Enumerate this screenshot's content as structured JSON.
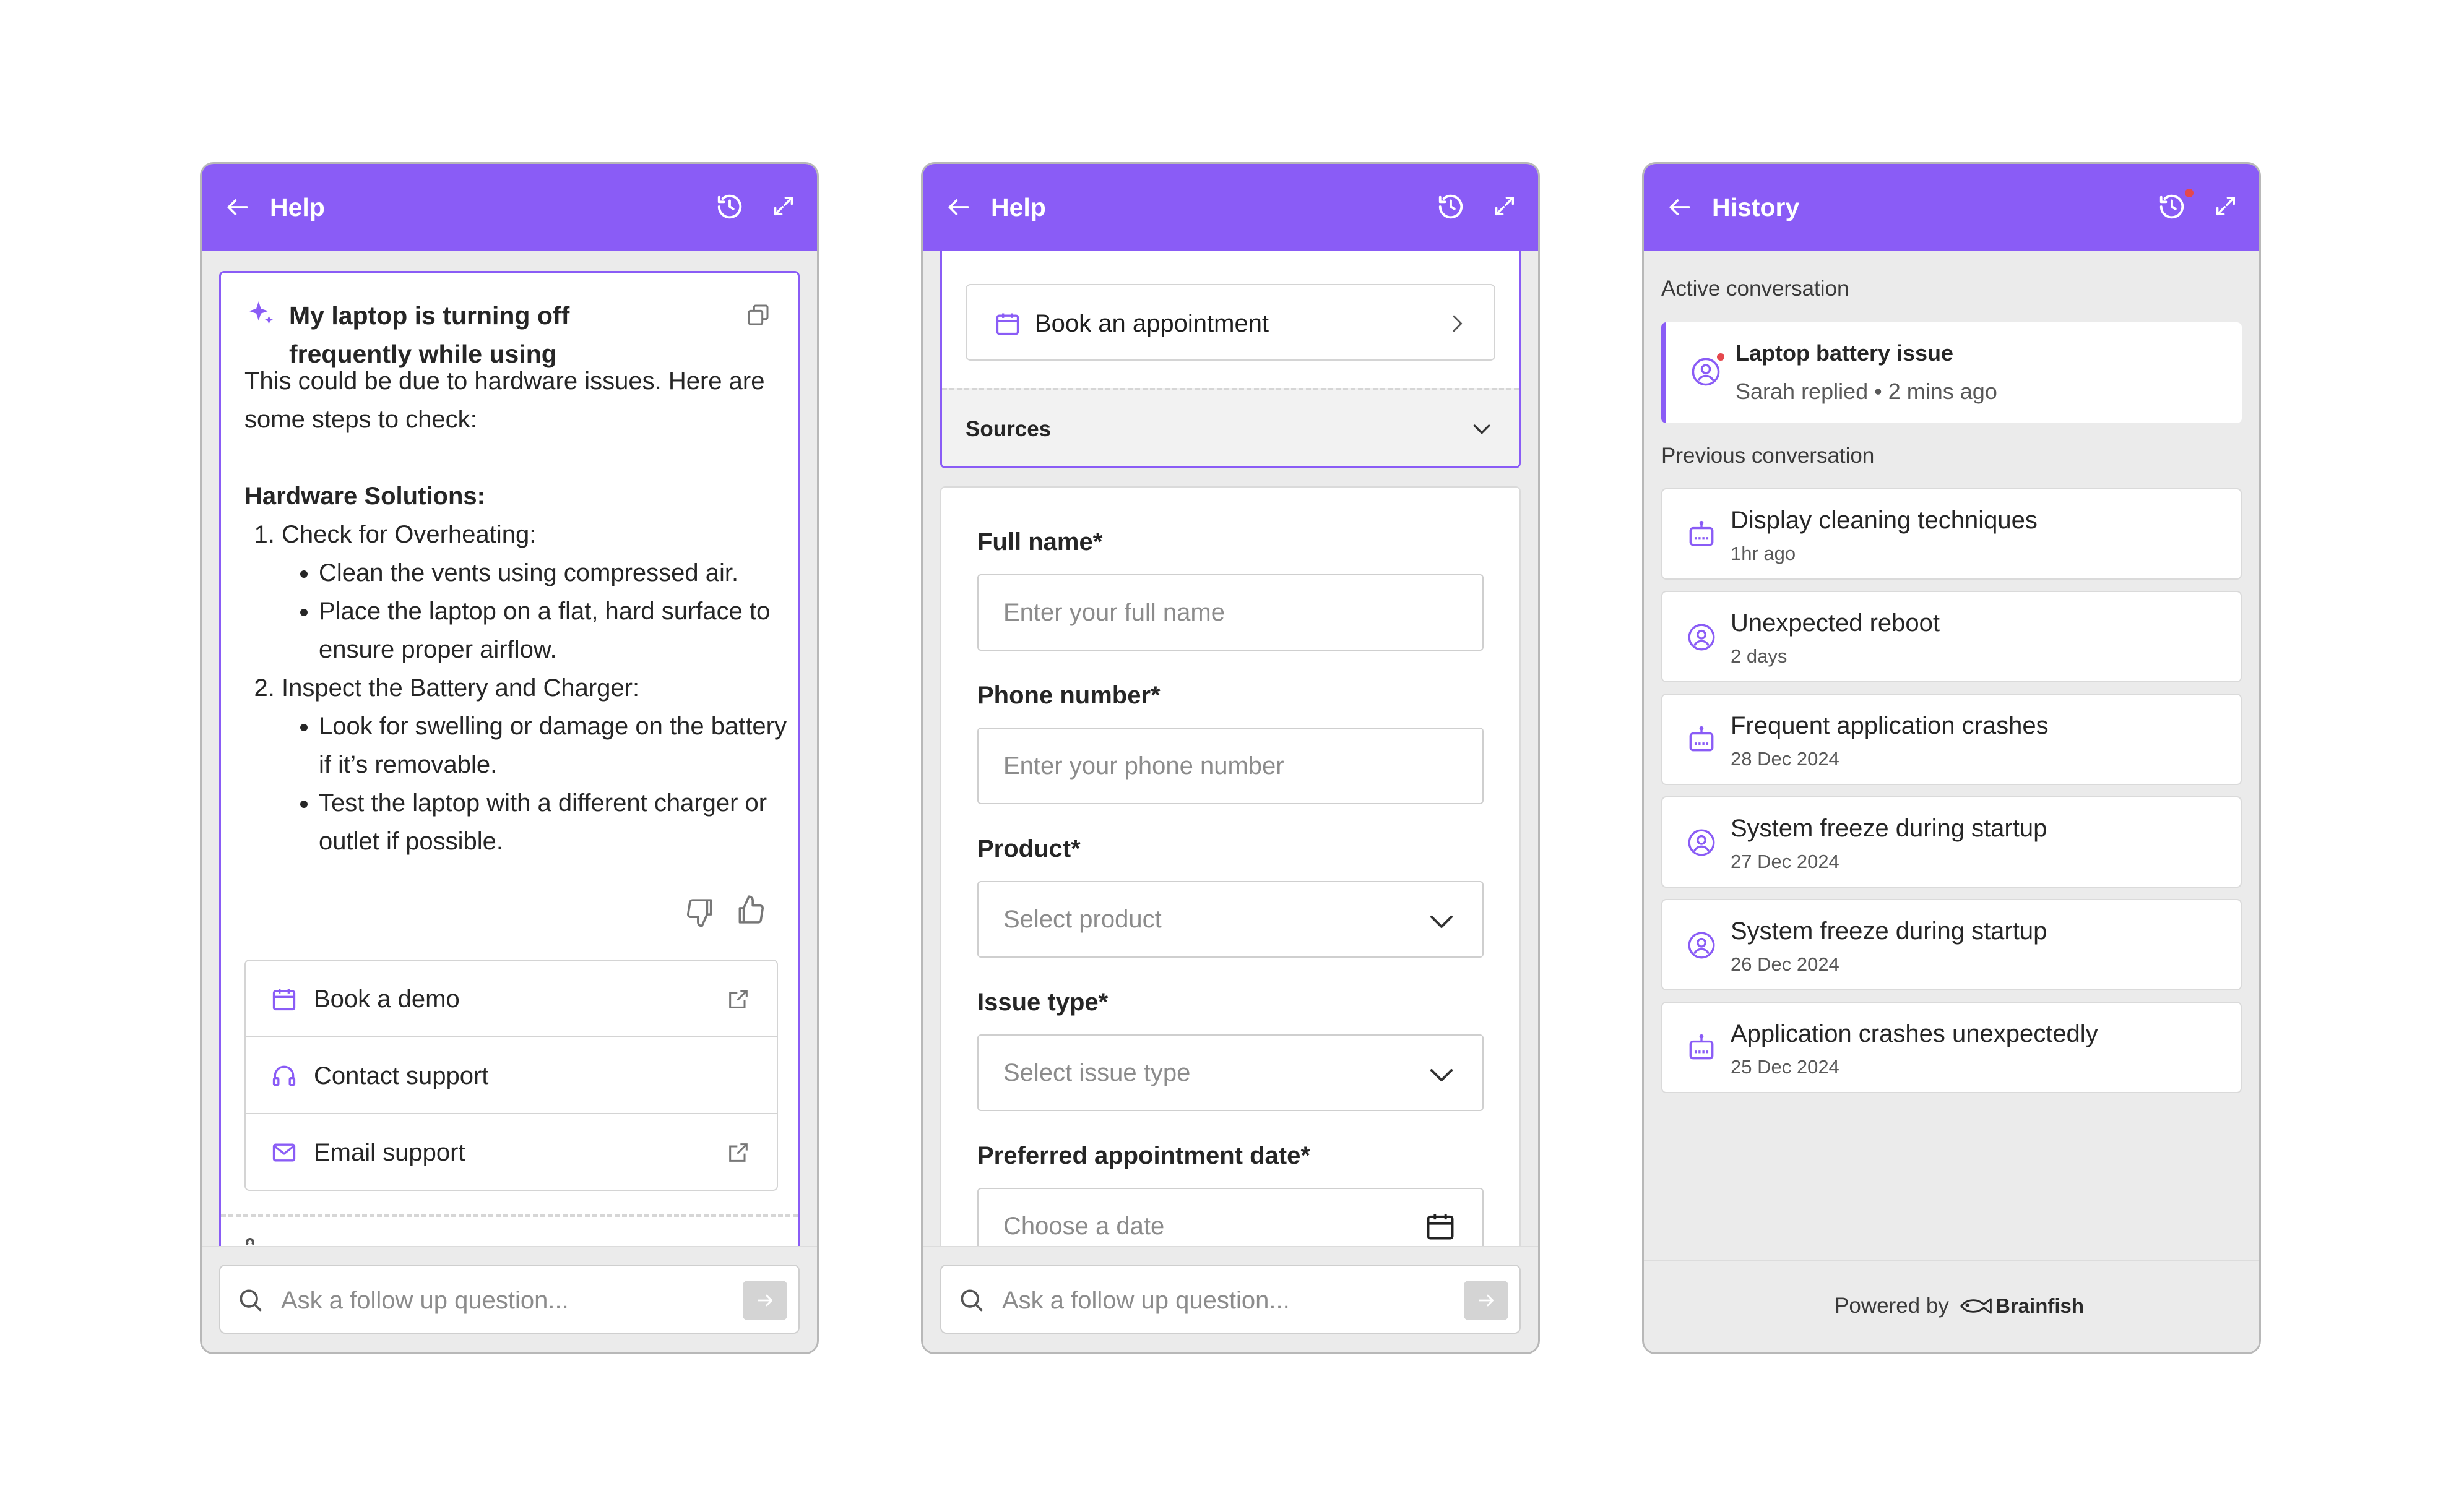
{
  "colors": {
    "accent": "#8a5cf6",
    "panel_bg": "#ebebeb",
    "notification": "#e5484d"
  },
  "chat_panel": {
    "header": {
      "title": "Help"
    },
    "question": "My laptop is turning off frequently while using",
    "answer": {
      "intro": "This could be due to hardware issues. Here are some steps to check:",
      "section_title": "Hardware Solutions:",
      "steps": [
        {
          "title": "Check for Overheating:",
          "bullets": [
            "Clean the vents using compressed air.",
            "Place the laptop on a flat, hard surface to ensure proper airflow."
          ]
        },
        {
          "title": "Inspect the Battery and Charger:",
          "bullets": [
            "Look for swelling or damage on the battery if it’s removable.",
            "Test the laptop with a different charger or outlet if possible."
          ]
        }
      ]
    },
    "actions": [
      {
        "label": "Book a demo",
        "icon": "calendar-icon",
        "external": true
      },
      {
        "label": "Contact support",
        "icon": "headset-icon",
        "external": false
      },
      {
        "label": "Email support",
        "icon": "mail-icon",
        "external": true
      }
    ],
    "input_placeholder": "Ask a follow up question..."
  },
  "form_panel": {
    "header": {
      "title": "Help"
    },
    "appointment_label": "Book an appointment",
    "sources_label": "Sources",
    "fields": {
      "full_name": {
        "label": "Full name*",
        "placeholder": "Enter your full name"
      },
      "phone": {
        "label": "Phone number*",
        "placeholder": "Enter your phone number"
      },
      "product": {
        "label": "Product*",
        "placeholder": "Select product"
      },
      "issue_type": {
        "label": "Issue type*",
        "placeholder": "Select issue type"
      },
      "date": {
        "label": "Preferred appointment date*",
        "placeholder": "Choose a date"
      }
    },
    "input_placeholder": "Ask a follow up question..."
  },
  "history_panel": {
    "header": {
      "title": "History"
    },
    "active_section": "Active conversation",
    "active": {
      "title": "Laptop battery issue",
      "subtitle": "Sarah replied • 2 mins ago"
    },
    "previous_section": "Previous conversation",
    "items": [
      {
        "title": "Display cleaning techniques",
        "time": "1hr ago",
        "icon": "bot-icon"
      },
      {
        "title": "Unexpected reboot",
        "time": "2 days",
        "icon": "user-icon"
      },
      {
        "title": "Frequent application crashes",
        "time": "28 Dec 2024",
        "icon": "bot-icon"
      },
      {
        "title": "System freeze during startup",
        "time": "27 Dec 2024",
        "icon": "user-icon"
      },
      {
        "title": "System freeze during startup",
        "time": "26 Dec 2024",
        "icon": "user-icon"
      },
      {
        "title": "Application crashes unexpectedly",
        "time": "25 Dec 2024",
        "icon": "bot-icon"
      }
    ],
    "powered_by": "Powered by",
    "brand": "Brainfish"
  }
}
